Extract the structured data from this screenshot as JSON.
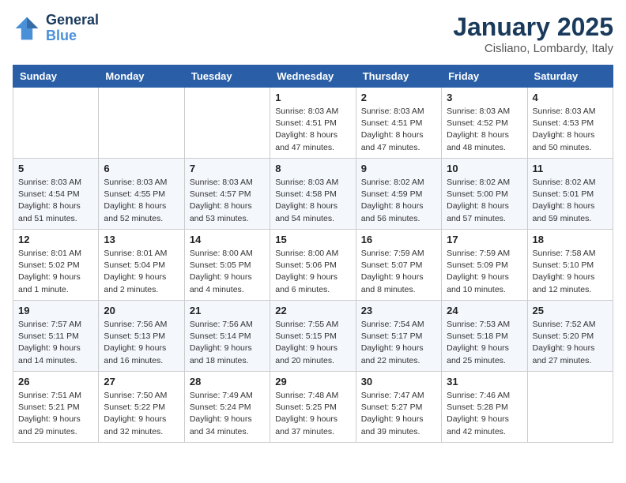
{
  "logo": {
    "line1": "General",
    "line2": "Blue"
  },
  "title": "January 2025",
  "location": "Cisliano, Lombardy, Italy",
  "days_of_week": [
    "Sunday",
    "Monday",
    "Tuesday",
    "Wednesday",
    "Thursday",
    "Friday",
    "Saturday"
  ],
  "weeks": [
    [
      {
        "day": "",
        "content": ""
      },
      {
        "day": "",
        "content": ""
      },
      {
        "day": "",
        "content": ""
      },
      {
        "day": "1",
        "content": "Sunrise: 8:03 AM\nSunset: 4:51 PM\nDaylight: 8 hours\nand 47 minutes."
      },
      {
        "day": "2",
        "content": "Sunrise: 8:03 AM\nSunset: 4:51 PM\nDaylight: 8 hours\nand 47 minutes."
      },
      {
        "day": "3",
        "content": "Sunrise: 8:03 AM\nSunset: 4:52 PM\nDaylight: 8 hours\nand 48 minutes."
      },
      {
        "day": "4",
        "content": "Sunrise: 8:03 AM\nSunset: 4:53 PM\nDaylight: 8 hours\nand 50 minutes."
      }
    ],
    [
      {
        "day": "5",
        "content": "Sunrise: 8:03 AM\nSunset: 4:54 PM\nDaylight: 8 hours\nand 51 minutes."
      },
      {
        "day": "6",
        "content": "Sunrise: 8:03 AM\nSunset: 4:55 PM\nDaylight: 8 hours\nand 52 minutes."
      },
      {
        "day": "7",
        "content": "Sunrise: 8:03 AM\nSunset: 4:57 PM\nDaylight: 8 hours\nand 53 minutes."
      },
      {
        "day": "8",
        "content": "Sunrise: 8:03 AM\nSunset: 4:58 PM\nDaylight: 8 hours\nand 54 minutes."
      },
      {
        "day": "9",
        "content": "Sunrise: 8:02 AM\nSunset: 4:59 PM\nDaylight: 8 hours\nand 56 minutes."
      },
      {
        "day": "10",
        "content": "Sunrise: 8:02 AM\nSunset: 5:00 PM\nDaylight: 8 hours\nand 57 minutes."
      },
      {
        "day": "11",
        "content": "Sunrise: 8:02 AM\nSunset: 5:01 PM\nDaylight: 8 hours\nand 59 minutes."
      }
    ],
    [
      {
        "day": "12",
        "content": "Sunrise: 8:01 AM\nSunset: 5:02 PM\nDaylight: 9 hours\nand 1 minute."
      },
      {
        "day": "13",
        "content": "Sunrise: 8:01 AM\nSunset: 5:04 PM\nDaylight: 9 hours\nand 2 minutes."
      },
      {
        "day": "14",
        "content": "Sunrise: 8:00 AM\nSunset: 5:05 PM\nDaylight: 9 hours\nand 4 minutes."
      },
      {
        "day": "15",
        "content": "Sunrise: 8:00 AM\nSunset: 5:06 PM\nDaylight: 9 hours\nand 6 minutes."
      },
      {
        "day": "16",
        "content": "Sunrise: 7:59 AM\nSunset: 5:07 PM\nDaylight: 9 hours\nand 8 minutes."
      },
      {
        "day": "17",
        "content": "Sunrise: 7:59 AM\nSunset: 5:09 PM\nDaylight: 9 hours\nand 10 minutes."
      },
      {
        "day": "18",
        "content": "Sunrise: 7:58 AM\nSunset: 5:10 PM\nDaylight: 9 hours\nand 12 minutes."
      }
    ],
    [
      {
        "day": "19",
        "content": "Sunrise: 7:57 AM\nSunset: 5:11 PM\nDaylight: 9 hours\nand 14 minutes."
      },
      {
        "day": "20",
        "content": "Sunrise: 7:56 AM\nSunset: 5:13 PM\nDaylight: 9 hours\nand 16 minutes."
      },
      {
        "day": "21",
        "content": "Sunrise: 7:56 AM\nSunset: 5:14 PM\nDaylight: 9 hours\nand 18 minutes."
      },
      {
        "day": "22",
        "content": "Sunrise: 7:55 AM\nSunset: 5:15 PM\nDaylight: 9 hours\nand 20 minutes."
      },
      {
        "day": "23",
        "content": "Sunrise: 7:54 AM\nSunset: 5:17 PM\nDaylight: 9 hours\nand 22 minutes."
      },
      {
        "day": "24",
        "content": "Sunrise: 7:53 AM\nSunset: 5:18 PM\nDaylight: 9 hours\nand 25 minutes."
      },
      {
        "day": "25",
        "content": "Sunrise: 7:52 AM\nSunset: 5:20 PM\nDaylight: 9 hours\nand 27 minutes."
      }
    ],
    [
      {
        "day": "26",
        "content": "Sunrise: 7:51 AM\nSunset: 5:21 PM\nDaylight: 9 hours\nand 29 minutes."
      },
      {
        "day": "27",
        "content": "Sunrise: 7:50 AM\nSunset: 5:22 PM\nDaylight: 9 hours\nand 32 minutes."
      },
      {
        "day": "28",
        "content": "Sunrise: 7:49 AM\nSunset: 5:24 PM\nDaylight: 9 hours\nand 34 minutes."
      },
      {
        "day": "29",
        "content": "Sunrise: 7:48 AM\nSunset: 5:25 PM\nDaylight: 9 hours\nand 37 minutes."
      },
      {
        "day": "30",
        "content": "Sunrise: 7:47 AM\nSunset: 5:27 PM\nDaylight: 9 hours\nand 39 minutes."
      },
      {
        "day": "31",
        "content": "Sunrise: 7:46 AM\nSunset: 5:28 PM\nDaylight: 9 hours\nand 42 minutes."
      },
      {
        "day": "",
        "content": ""
      }
    ]
  ]
}
